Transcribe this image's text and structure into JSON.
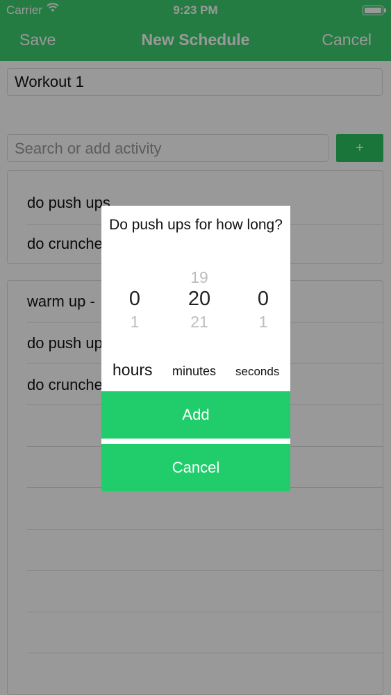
{
  "status_bar": {
    "carrier": "Carrier",
    "time": "9:23 PM"
  },
  "nav": {
    "save": "Save",
    "title": "New Schedule",
    "cancel": "Cancel"
  },
  "form": {
    "schedule_name": "Workout 1",
    "search_placeholder": "Search or add activity",
    "add_button": "+"
  },
  "suggestions": [
    "do push ups",
    "do crunche"
  ],
  "schedule_items": [
    "warm up -",
    "do push up",
    "do crunche"
  ],
  "dialog": {
    "question": "Do push ups for how long?",
    "hours": {
      "above": "",
      "selected": "0",
      "below": "1",
      "label": "hours"
    },
    "minutes": {
      "above": "19",
      "selected": "20",
      "below": "21",
      "label": "minutes"
    },
    "seconds": {
      "above": "",
      "selected": "0",
      "below": "1",
      "label": "seconds"
    },
    "add_button": "Add",
    "cancel_button": "Cancel"
  },
  "colors": {
    "accent": "#3ecf6f",
    "button": "#21cc6a",
    "overlay": "rgba(0,0,0,0.40)"
  }
}
